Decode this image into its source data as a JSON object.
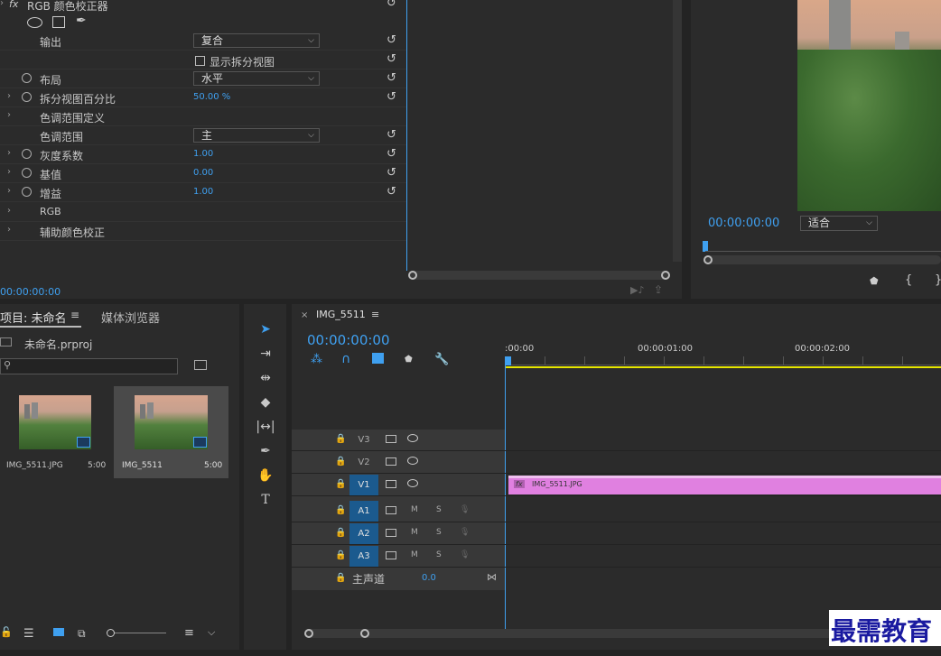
{
  "effect_controls": {
    "section_title": "RGB 颜色校正器",
    "fx_label": "fx",
    "rows": [
      {
        "label": "输出",
        "type": "dropdown",
        "value": "复合"
      },
      {
        "label": "显示拆分视图",
        "type": "checkbox",
        "checked": false
      },
      {
        "label": "布局",
        "type": "dropdown",
        "value": "水平",
        "stopwatch": true
      },
      {
        "label": "拆分视图百分比",
        "type": "value",
        "value": "50.00 %",
        "stopwatch": true,
        "twirl": true
      },
      {
        "label": "色调范围定义",
        "type": "group",
        "twirl": true
      },
      {
        "label": "色调范围",
        "type": "dropdown",
        "value": "主"
      },
      {
        "label": "灰度系数",
        "type": "value",
        "value": "1.00",
        "stopwatch": true,
        "twirl": true
      },
      {
        "label": "基值",
        "type": "value",
        "value": "0.00",
        "stopwatch": true,
        "twirl": true
      },
      {
        "label": "增益",
        "type": "value",
        "value": "1.00",
        "stopwatch": true,
        "twirl": true
      },
      {
        "label": "RGB",
        "type": "group",
        "twirl": true
      },
      {
        "label": "辅助颜色校正",
        "type": "group",
        "twirl": true
      }
    ],
    "timecode": "00:00:00:00"
  },
  "program_monitor": {
    "timecode": "00:00:00:00",
    "fit_select": "适合"
  },
  "project_panel": {
    "tab_project": "项目: 未命名",
    "tab_media": "媒体浏览器",
    "project_file": "未命名.prproj",
    "search_placeholder": "",
    "items": [
      {
        "name": "IMG_5511.JPG",
        "duration": "5:00",
        "selected": false
      },
      {
        "name": "IMG_5511",
        "duration": "5:00",
        "selected": true
      }
    ]
  },
  "tools": [
    "selection-tool",
    "track-select-tool",
    "ripple-edit-tool",
    "razor-tool",
    "slip-tool",
    "pen-tool",
    "hand-tool",
    "type-tool"
  ],
  "timeline": {
    "tab_title": "IMG_5511",
    "timecode": "00:00:00:00",
    "ruler": [
      ":00:00",
      "00:00:01:00",
      "00:00:02:00"
    ],
    "video_tracks": [
      {
        "name": "V3",
        "on": false
      },
      {
        "name": "V2",
        "on": false
      },
      {
        "name": "V1",
        "on": true
      }
    ],
    "audio_tracks": [
      {
        "name": "A1",
        "m": "M",
        "s": "S"
      },
      {
        "name": "A2",
        "m": "M",
        "s": "S"
      },
      {
        "name": "A3",
        "m": "M",
        "s": "S"
      }
    ],
    "master": {
      "label": "主声道",
      "value": "0.0"
    },
    "clip": {
      "label": "IMG_5511.JPG",
      "fx": "fx",
      "color": "#e080e0"
    }
  },
  "watermark": "最需教育"
}
